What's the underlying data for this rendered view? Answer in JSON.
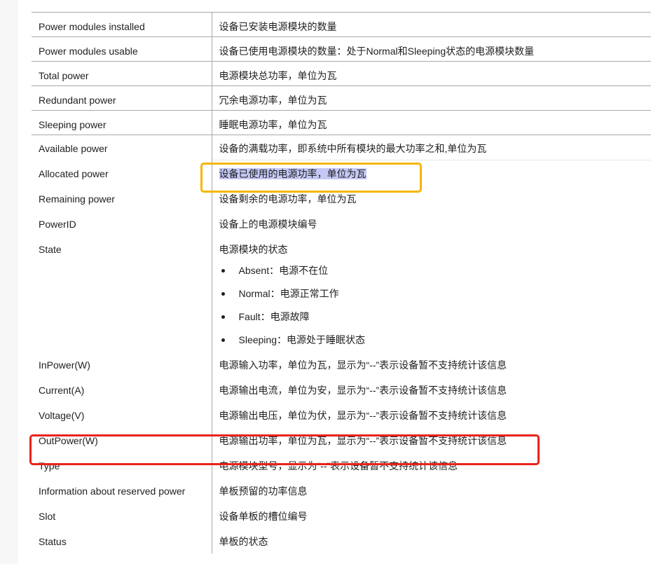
{
  "rows": [
    {
      "name": "Power modules installed",
      "desc": "设备已安装电源模块的数量"
    },
    {
      "name": "Power modules usable",
      "desc": "设备已使用电源模块的数量：处于Normal和Sleeping状态的电源模块数量"
    },
    {
      "name": "Total power",
      "desc": "电源模块总功率，单位为瓦"
    },
    {
      "name": "Redundant power",
      "desc": "冗余电源功率，单位为瓦"
    },
    {
      "name": "Sleeping power",
      "desc": "睡眠电源功率，单位为瓦"
    },
    {
      "name": "Available power",
      "desc": "设备的满载功率，即系统中所有模块的最大功率之和,单位为瓦"
    },
    {
      "name": "Allocated power",
      "desc": "设备已使用的电源功率，单位为瓦"
    },
    {
      "name": "Remaining power",
      "desc": "设备剩余的电源功率，单位为瓦"
    },
    {
      "name": "PowerID",
      "desc": "设备上的电源模块编号"
    },
    {
      "name": "State",
      "desc": "电源模块的状态"
    },
    {
      "name": "InPower(W)",
      "desc": "电源输入功率，单位为瓦，显示为“--”表示设备暂不支持统计该信息"
    },
    {
      "name": "Current(A)",
      "desc": "电源输出电流，单位为安，显示为“--”表示设备暂不支持统计该信息"
    },
    {
      "name": "Voltage(V)",
      "desc": "电源输出电压，单位为伏，显示为“--”表示设备暂不支持统计该信息"
    },
    {
      "name": "OutPower(W)",
      "desc": "电源输出功率，单位为瓦，显示为“--”表示设备暂不支持统计该信息"
    },
    {
      "name": "Type",
      "desc": "电源模块型号，显示为“--”表示设备暂不支持统计该信息"
    },
    {
      "name": "Information about reserved power",
      "desc": "单板预留的功率信息"
    },
    {
      "name": "Slot",
      "desc": "设备单板的槽位编号"
    },
    {
      "name": "Status",
      "desc": "单板的状态"
    }
  ],
  "state_options": [
    "Absent：电源不在位",
    "Normal：电源正常工作",
    "Fault：电源故障",
    "Sleeping：电源处于睡眠状态"
  ],
  "annotation_colors": {
    "yellow": "#f7b500",
    "red": "#e8231b",
    "selection": "#c5c8f5"
  }
}
